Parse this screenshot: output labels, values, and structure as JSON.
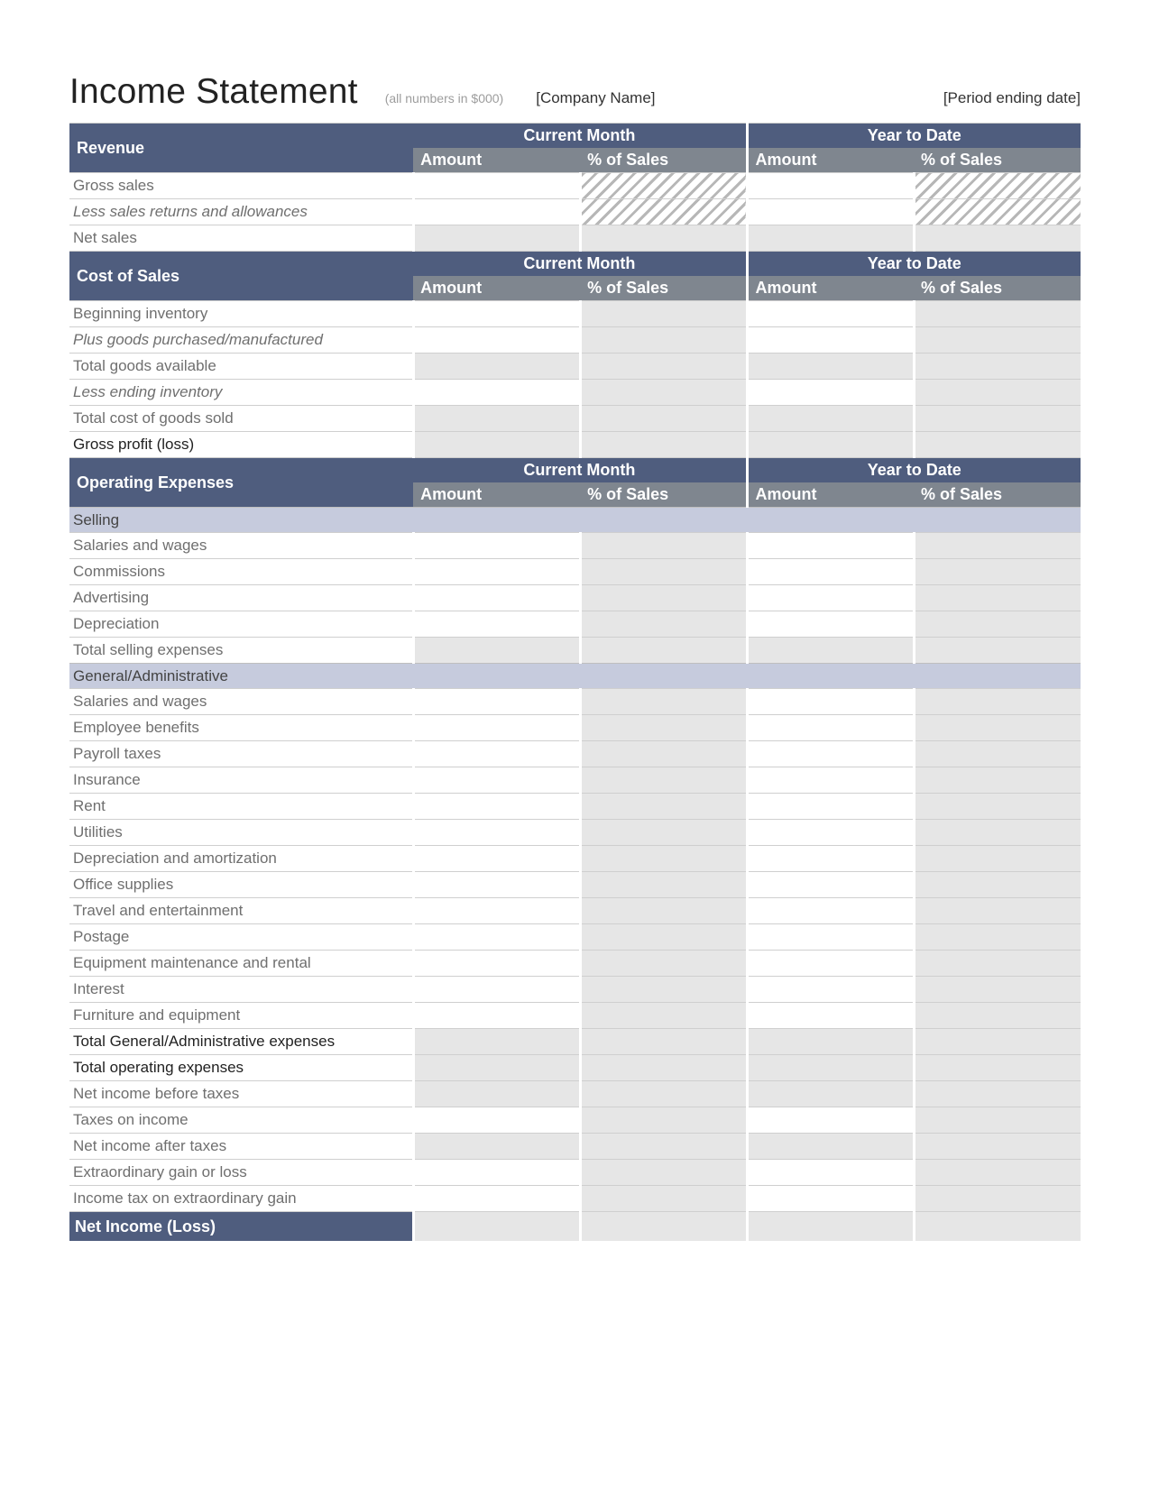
{
  "title": "Income Statement",
  "subtitle": "(all numbers in $000)",
  "company": "[Company Name]",
  "period": "[Period ending date]",
  "col": {
    "current": "Current Month",
    "ytd": "Year to Date",
    "amount": "Amount",
    "pct": "% of Sales"
  },
  "sections": {
    "revenue": {
      "title": "Revenue",
      "rows": {
        "gross": "Gross sales",
        "less": "Less sales returns and allowances",
        "net": "Net sales"
      }
    },
    "cos": {
      "title": "Cost of Sales",
      "rows": {
        "begin": "Beginning inventory",
        "plus": "Plus goods purchased/manufactured",
        "total_goods": "Total goods available",
        "less_end": "Less ending inventory",
        "total_cogs": "Total cost of goods sold",
        "gross_profit": "Gross profit (loss)"
      }
    },
    "opex": {
      "title": "Operating Expenses",
      "selling": {
        "title": "Selling",
        "rows": {
          "sal": "Salaries and wages",
          "comm": "Commissions",
          "adv": "Advertising",
          "dep": "Depreciation",
          "total": "Total selling expenses"
        }
      },
      "ga": {
        "title": "General/Administrative",
        "rows": {
          "sal": "Salaries and wages",
          "ben": "Employee benefits",
          "pay": "Payroll taxes",
          "ins": "Insurance",
          "rent": "Rent",
          "util": "Utilities",
          "da": "Depreciation and amortization",
          "off": "Office supplies",
          "trav": "Travel and entertainment",
          "post": "Postage",
          "equip": "Equipment maintenance and rental",
          "int": "Interest",
          "furn": "Furniture and equipment",
          "total_ga": "Total General/Administrative expenses",
          "total_op": "Total operating expenses",
          "nibt": "Net income before taxes",
          "tax": "Taxes on income",
          "niat": "Net income after taxes",
          "extra": "Extraordinary gain or loss",
          "itax": "Income tax on extraordinary gain"
        }
      }
    },
    "net": "Net Income (Loss)"
  }
}
